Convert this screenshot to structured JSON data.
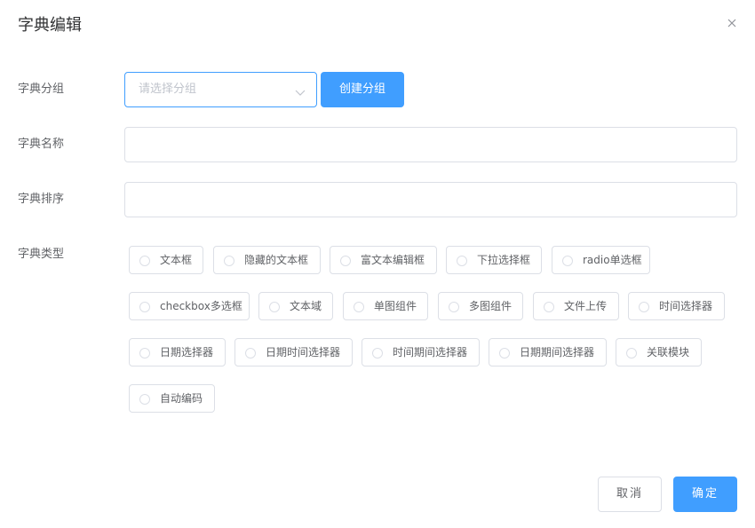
{
  "dialog": {
    "title": "字典编辑",
    "close_icon": "close-icon"
  },
  "form": {
    "group": {
      "label": "字典分组",
      "select_placeholder": "请选择分组",
      "create_button": "创建分组"
    },
    "name": {
      "label": "字典名称",
      "value": ""
    },
    "sort": {
      "label": "字典排序",
      "value": ""
    },
    "type": {
      "label": "字典类型",
      "options": [
        "文本框",
        "隐藏的文本框",
        "富文本编辑框",
        "下拉选择框",
        "radio单选框",
        "checkbox多选框",
        "文本域",
        "单图组件",
        "多图组件",
        "文件上传",
        "时间选择器",
        "日期选择器",
        "日期时间选择器",
        "时间期间选择器",
        "日期期间选择器",
        "关联模块",
        "自动编码"
      ],
      "selected": null
    }
  },
  "footer": {
    "cancel_label": "取消",
    "ok_label": "确定"
  },
  "colors": {
    "primary": "#409eff",
    "border": "#dcdfe6",
    "text": "#606266",
    "placeholder": "#c0c4cc"
  }
}
